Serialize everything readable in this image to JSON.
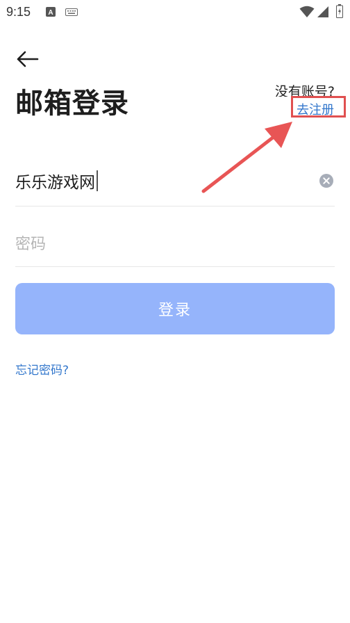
{
  "status_bar": {
    "time": "9:15",
    "icons_left": [
      "a-notification-icon",
      "keyboard-icon"
    ],
    "icons_right": [
      "wifi-icon",
      "signal-icon",
      "battery-icon"
    ]
  },
  "header": {
    "back_icon": "arrow-left-icon",
    "title": "邮箱登录",
    "no_account_text": "没有账号?",
    "register_label": "去注册"
  },
  "form": {
    "email_value": "乐乐游戏网",
    "password_placeholder": "密码",
    "clear_icon": "clear-circle-icon"
  },
  "login_button": {
    "label": "登录"
  },
  "forgot_password": {
    "label": "忘记密码?"
  },
  "colors": {
    "accent_link": "#3377cc",
    "button_disabled": "#95b4fb",
    "annotation": "#e05050"
  }
}
